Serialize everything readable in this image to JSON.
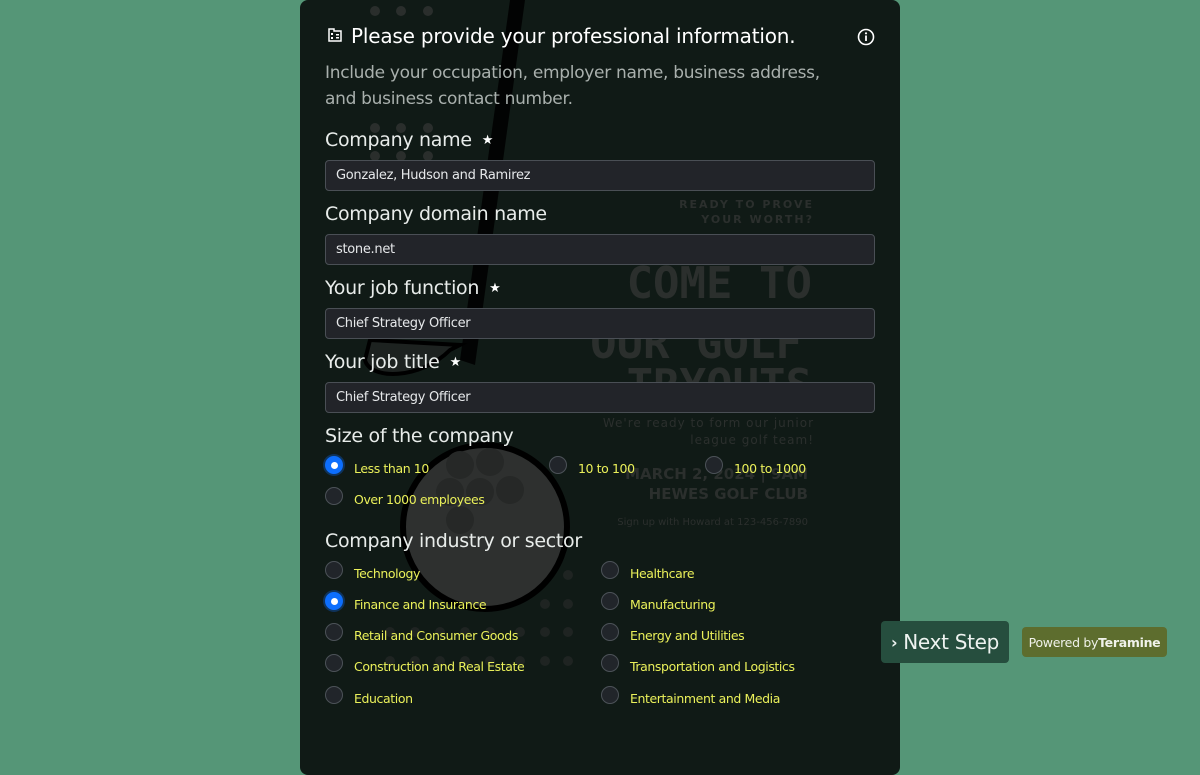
{
  "form": {
    "title": "Please provide your professional information.",
    "subtitle": "Include your occupation, employer name, business address, and business contact number.",
    "icons": {
      "header": "building-icon",
      "info": "info-icon"
    },
    "fields": [
      {
        "label": "Company name",
        "required": true,
        "required_mark": "★",
        "value": "Gonzalez, Hudson and Ramirez"
      },
      {
        "label": "Company domain name",
        "required": false,
        "value": "stone.net"
      },
      {
        "label": "Your job function",
        "required": true,
        "required_mark": "★",
        "value": "Chief Strategy Officer"
      },
      {
        "label": "Your job title",
        "required": true,
        "required_mark": "★",
        "value": "Chief Strategy Officer"
      }
    ],
    "company_size": {
      "label": "Size of the company",
      "selected": "Less than 10",
      "options": [
        "Less than 10",
        "10 to 100",
        "100 to 1000",
        "Over 1000 employees"
      ]
    },
    "industry": {
      "label": "Company industry or sector",
      "selected": "Finance and Insurance",
      "options": [
        "Technology",
        "Healthcare",
        "Finance and Insurance",
        "Manufacturing",
        "Retail and Consumer Goods",
        "Energy and Utilities",
        "Construction and Real Estate",
        "Transportation and Logistics",
        "Education",
        "Entertainment and Media"
      ]
    }
  },
  "background_poster": {
    "line1": "READY TO PROVE",
    "line2": "YOUR WORTH?",
    "headline1": "COME TO",
    "headline2": "OUR GOLF",
    "headline3": "TRYOUTS",
    "tagline1": "We're ready to form our junior",
    "tagline2": "league golf team!",
    "date": "MARCH 2, 2024 | 9AM",
    "venue": "HEWES GOLF CLUB",
    "contact": "Sign up with Howard at 123-456-7890"
  },
  "actions": {
    "next_label": "Next Step",
    "next_icon": "›",
    "powered_prefix": "Powered by",
    "powered_brand": "Teramine"
  },
  "colors": {
    "page_bg": "#559677",
    "card_bg": "#101a16",
    "radio_accent": "#0d6efd",
    "option_text": "#eaf05a",
    "next_button": "#264e3e",
    "powered_badge": "#5d6d2e"
  }
}
